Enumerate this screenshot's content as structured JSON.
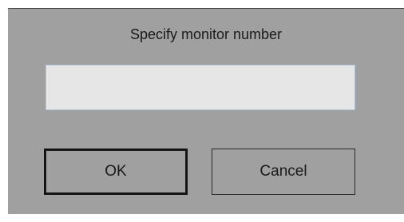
{
  "dialog": {
    "prompt": "Specify monitor number",
    "input": {
      "value": "",
      "placeholder": ""
    },
    "buttons": {
      "ok_label": "OK",
      "cancel_label": "Cancel"
    }
  }
}
